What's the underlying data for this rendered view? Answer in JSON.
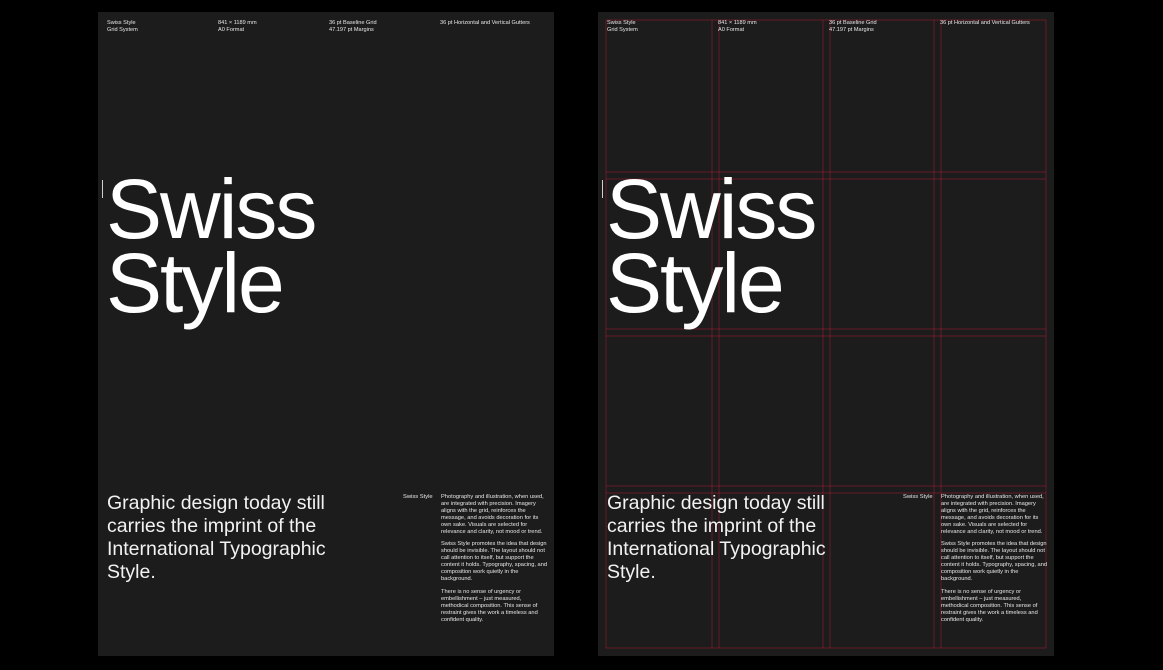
{
  "accent": "#e0203a",
  "poster_background": "#1c1c1c",
  "posters": [
    {
      "variant": "plain",
      "meta": {
        "col1_line1": "Swiss Style",
        "col1_line2": "Grid System",
        "col2_line1": "841 × 1189 mm",
        "col2_line2": "A0 Format",
        "col3_line1": "36 pt Baseline Grid",
        "col3_line2": "47.197 pt Margins",
        "col4_line1": "36 pt Horizontal and Vertical Gutters"
      },
      "headline_line1": "Swiss",
      "headline_line2": "Style",
      "subhead": "Graphic design today still carries the imprint of the International Typographic Style.",
      "side_label": "Swiss Style",
      "body_p1": "Photography and illustration, when used, are integrated with precision. Imagery aligns with the grid, reinforces the message, and avoids decoration for its own sake. Visuals are selected for relevance and clarity, not mood or trend.",
      "body_p2": "Swiss Style promotes the idea that design should be invisible. The layout should not call attention to itself, but support the content it holds. Typography, spacing, and composition work quietly in the background.",
      "body_p3": "There is no sense of urgency or embellishment – just measured, methodical composition. This sense of restraint gives the work a timeless and confident quality."
    },
    {
      "variant": "grid",
      "meta": {
        "col1_line1": "Swiss Style",
        "col1_line2": "Grid System",
        "col2_line1": "841 × 1189 mm",
        "col2_line2": "A0 Format",
        "col3_line1": "36 pt Baseline Grid",
        "col3_line2": "47.197 pt Margins",
        "col4_line1": "36 pt Horizontal and Vertical Gutters"
      },
      "headline_line1": "Swiss",
      "headline_line2": "Style",
      "subhead": "Graphic design today still carries the imprint of the International Typographic Style.",
      "side_label": "Swiss Style",
      "body_p1": "Photography and illustration, when used, are integrated with precision. Imagery aligns with the grid, reinforces the message, and avoids decoration for its own sake. Visuals are selected for relevance and clarity, not mood or trend.",
      "body_p2": "Swiss Style promotes the idea that design should be invisible. The layout should not call attention to itself, but support the content it holds. Typography, spacing, and composition work quietly in the background.",
      "body_p3": "There is no sense of urgency or embellishment – just measured, methodical composition. This sense of restraint gives the work a timeless and confident quality."
    }
  ]
}
